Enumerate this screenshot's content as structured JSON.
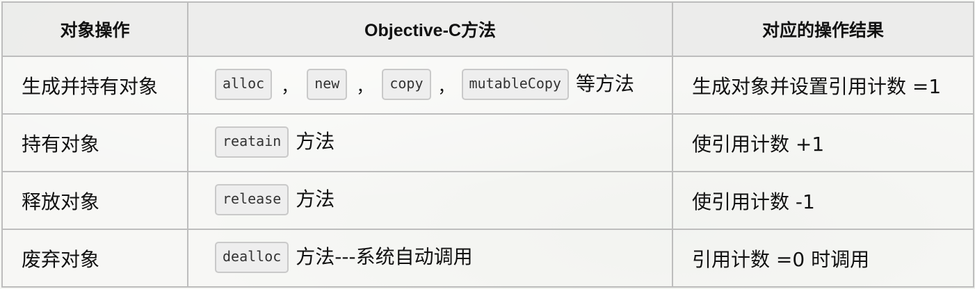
{
  "table": {
    "headers": [
      "对象操作",
      "Objective-C方法",
      "对应的操作结果"
    ],
    "rows": [
      {
        "operation": "生成并持有对象",
        "methods": [
          "alloc",
          "new",
          "copy",
          "mutableCopy"
        ],
        "separator": "，",
        "method_suffix": "等方法",
        "result": "生成对象并设置引用计数 =1"
      },
      {
        "operation": "持有对象",
        "methods": [
          "reatain"
        ],
        "method_suffix": "方法",
        "result": "使引用计数 +1"
      },
      {
        "operation": "释放对象",
        "methods": [
          "release"
        ],
        "method_suffix": "方法",
        "result": "使引用计数 -1"
      },
      {
        "operation": "废弃对象",
        "methods": [
          "dealloc"
        ],
        "method_suffix": "方法---系统自动调用",
        "result": "引用计数 =0 时调用"
      }
    ]
  }
}
